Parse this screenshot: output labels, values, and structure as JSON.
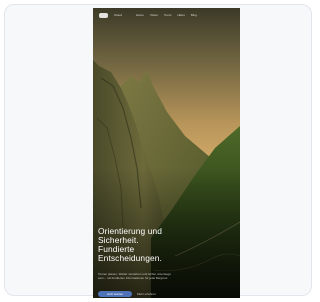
{
  "nav": {
    "brand": "Cloud",
    "items": [
      "Home",
      "Vision",
      "Tours",
      "Hikes",
      "Blog"
    ]
  },
  "hero": {
    "title_lines": [
      "Orientierung und",
      "Sicherheit.",
      "Fundierte",
      "Entscheidungen."
    ],
    "subtitle": "Touren planen, Wetter verstehen und sicher unterwegs sein – mit fundierten Informationen für jede Bergtour.",
    "cta_label": "Jetzt starten",
    "secondary_label": "Mehr erfahren"
  },
  "colors": {
    "accent": "#4f73b8",
    "sky_top": "#403b26",
    "sky_bottom": "#c8a060"
  }
}
